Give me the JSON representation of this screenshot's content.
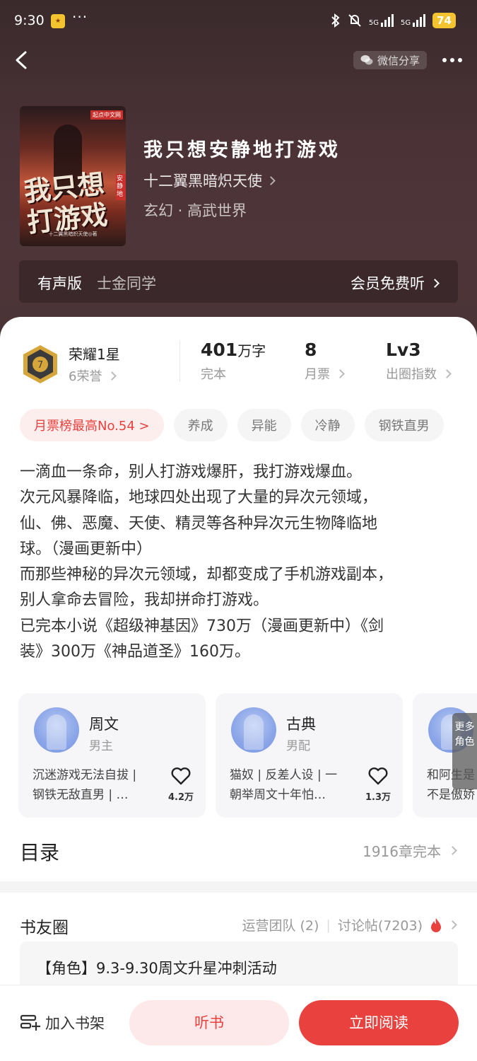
{
  "status_bar": {
    "time": "9:30",
    "dots": "···",
    "battery": "74",
    "network_1": "5G",
    "network_2": "5G"
  },
  "nav": {
    "share_label": "微信分享"
  },
  "book": {
    "title": "我只想安静地打游戏",
    "author": "十二翼黑暗炽天使",
    "genre": "玄幻 · 高武世界",
    "cover_title": "我只想打游戏",
    "cover_tag": "安静地",
    "cover_publisher": "起点中文网",
    "cover_author": "十二翼黑暗炽天使◎著"
  },
  "audio": {
    "label": "有声版",
    "narrator": "士金同学",
    "cta": "会员免费听"
  },
  "stats": {
    "honor_title": "荣耀1星",
    "honor_sub": "6荣誉",
    "words_value": "401",
    "words_unit": "万字",
    "words_label": "完本",
    "monthly_value": "8",
    "monthly_label": "月票",
    "level_value": "Lv3",
    "level_label": "出圈指数"
  },
  "tags": [
    "月票榜最高No.54 >",
    "养成",
    "异能",
    "冷静",
    "钢铁直男"
  ],
  "synopsis": [
    "一滴血一条命，别人打游戏爆肝，我打游戏爆血。",
    "次元风暴降临，地球四处出现了大量的异次元领域，",
    "仙、佛、恶魔、天使、精灵等各种异次元生物降临地",
    "球。（漫画更新中）",
    "而那些神秘的异次元领域，却都变成了手机游戏副本，",
    "别人拿命去冒险，我却拼命打游戏。",
    "已完本小说《超级神基因》730万（漫画更新中）《剑",
    "装》300万《神品道圣》160万。"
  ],
  "roles": [
    {
      "name": "周文",
      "type": "男主",
      "desc_1": "沉迷游戏无法自拔 |",
      "desc_2": "钢铁无敌直男 | …",
      "likes": "4.2万"
    },
    {
      "name": "古典",
      "type": "男配",
      "desc_1": "猫奴 | 反差人设 | 一",
      "desc_2": "朝举周文十年怕…",
      "likes": "1.3万"
    },
    {
      "name": "",
      "type": "",
      "desc_1": "和阿生是",
      "desc_2": "不是傲娇",
      "likes": ""
    }
  ],
  "more_roles": "更多角色",
  "toc": {
    "title": "目录",
    "status": "1916章完本"
  },
  "circle": {
    "title": "书友圈",
    "team": "运营团队 (2)",
    "posts": "讨论帖(7203)",
    "post_text": "【角色】9.3-9.30周文升星冲刺活动"
  },
  "bottom": {
    "shelf": "加入书架",
    "listen": "听书",
    "read": "立即阅读"
  },
  "colors": {
    "accent": "#e8413e",
    "hero_bg": "#4a3236"
  }
}
